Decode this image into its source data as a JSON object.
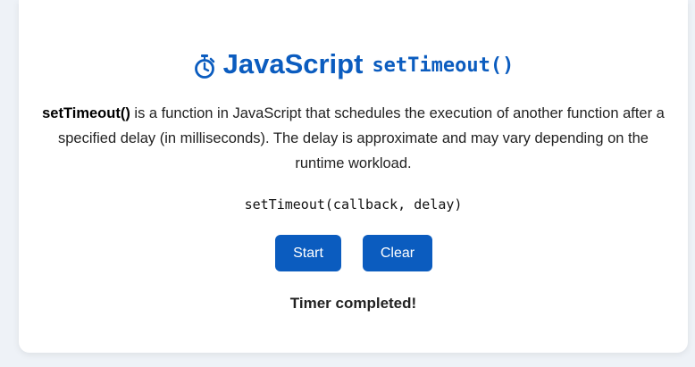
{
  "title": {
    "icon": "stopwatch-icon",
    "main": "JavaScript",
    "code": "setTimeout()"
  },
  "description": {
    "term": "setTimeout()",
    "text": " is a function in JavaScript that schedules the execution of another function after a specified delay (in milliseconds). The delay is approximate and may vary depending on the runtime workload."
  },
  "signature": "setTimeout(callback, delay)",
  "buttons": {
    "start_label": "Start",
    "clear_label": "Clear"
  },
  "status": "Timer completed!",
  "colors": {
    "accent": "#0b5cbf",
    "background": "#eef2f7",
    "card": "#ffffff"
  }
}
